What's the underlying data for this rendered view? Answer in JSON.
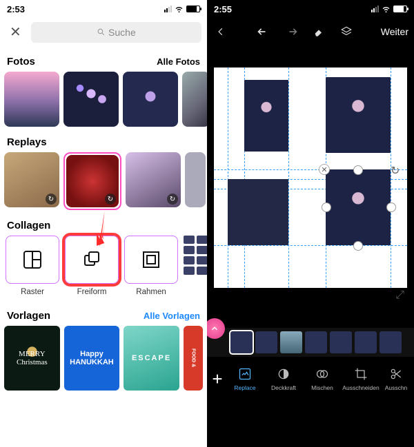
{
  "left": {
    "status_time": "2:53",
    "search_placeholder": "Suche",
    "sections": {
      "fotos": {
        "title": "Fotos",
        "link": "Alle Fotos"
      },
      "replays": {
        "title": "Replays"
      },
      "collagen": {
        "title": "Collagen",
        "items": [
          {
            "label": "Raster"
          },
          {
            "label": "Freiform"
          },
          {
            "label": "Rahmen"
          }
        ]
      },
      "vorlagen": {
        "title": "Vorlagen",
        "link": "Alle Vorlagen",
        "items": [
          {
            "label": "MERRY\nChristmas"
          },
          {
            "label": "Happy\nHANUKKAH"
          },
          {
            "label": "ESCAPE"
          },
          {
            "label": "FOOD &"
          }
        ]
      }
    },
    "accent_link_color": "#1e88ff"
  },
  "right": {
    "status_time": "2:55",
    "next_label": "Weiter",
    "bottom_tools": [
      {
        "label": "Replace",
        "active": true
      },
      {
        "label": "Deckkraft"
      },
      {
        "label": "Mischen"
      },
      {
        "label": "Ausschneiden"
      },
      {
        "label": "Ausschn"
      }
    ]
  }
}
